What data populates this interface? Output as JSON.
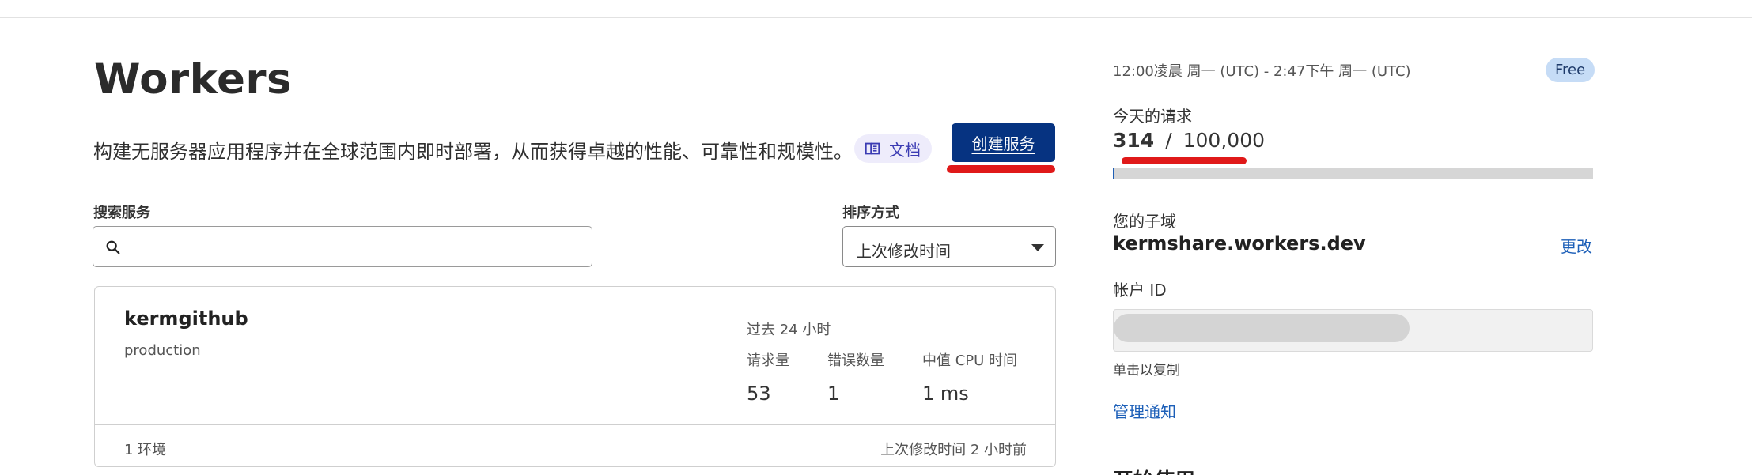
{
  "page": {
    "title": "Workers",
    "description": "构建无服务器应用程序并在全球范围内即时部署，从而获得卓越的性能、可靠性和规模性。",
    "docs_label": "文档",
    "create_button": "创建服务"
  },
  "search": {
    "label": "搜索服务",
    "value": "",
    "placeholder": ""
  },
  "sort": {
    "label": "排序方式",
    "selected": "上次修改时间"
  },
  "services": [
    {
      "name": "kermgithub",
      "environment": "production",
      "period": "过去 24 小时",
      "metrics": [
        {
          "label": "请求量",
          "value": "53"
        },
        {
          "label": "错误数量",
          "value": "1"
        },
        {
          "label": "中值 CPU 时间",
          "value": "1 ms"
        }
      ],
      "env_count": "1 环境",
      "last_modified": "上次修改时间 2 小时前"
    }
  ],
  "sidebar": {
    "time_range": "12:00凌晨 周一 (UTC) - 2:47下午 周一 (UTC)",
    "plan": "Free",
    "requests_label": "今天的请求",
    "requests_used": "314",
    "requests_separator": "/",
    "requests_limit": "100,000",
    "requests_fraction": 0.00314,
    "subdomain_label": "您的子域",
    "subdomain": "kermshare.workers.dev",
    "change_link": "更改",
    "account_id_label": "帐户 ID",
    "click_to_copy": "单击以复制",
    "manage_notifications": "管理通知",
    "get_started": "开始使用"
  },
  "colors": {
    "primary_button": "#063381",
    "link": "#1c5fb8",
    "plan_badge": "#c6dcf6",
    "annotation_red": "#e01919"
  },
  "icons": {
    "search": "search-icon",
    "docs": "book-icon",
    "sort_caret": "caret-down-icon"
  }
}
